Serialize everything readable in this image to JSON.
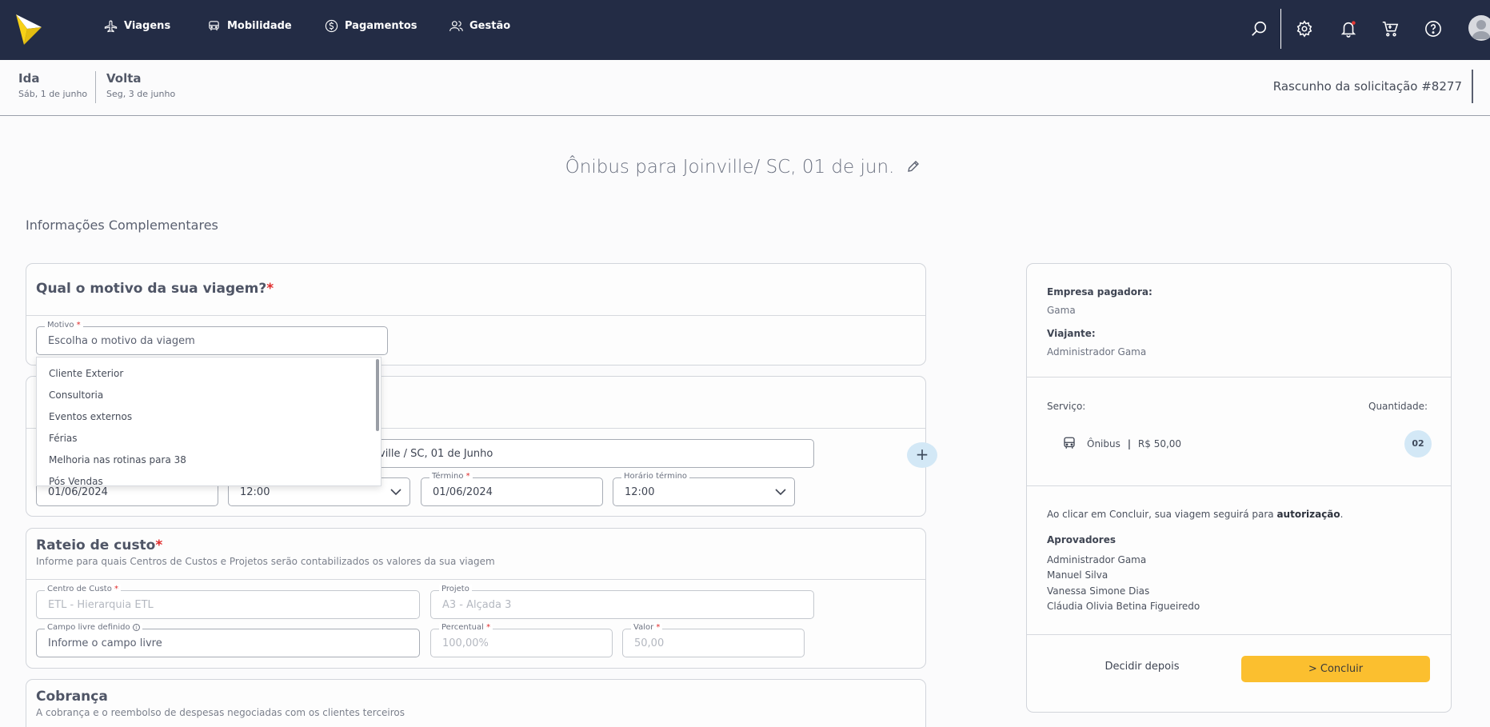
{
  "topbar": {
    "nav": [
      {
        "label": "Viagens",
        "icon": "airplane-icon"
      },
      {
        "label": "Mobilidade",
        "icon": "car-icon"
      },
      {
        "label": "Pagamentos",
        "icon": "dollar-icon"
      },
      {
        "label": "Gestão",
        "icon": "users-icon"
      }
    ],
    "icons": [
      "search-icon",
      "gear-icon",
      "bell-icon",
      "cart-icon",
      "help-icon",
      "avatar-icon"
    ],
    "bg_color": "#232c45",
    "logo_color": "#f7d117"
  },
  "trip": {
    "outbound": {
      "label": "Ida",
      "date": "Sáb, 1 de junho"
    },
    "return": {
      "label": "Volta",
      "date": "Seg, 3 de junho"
    },
    "draft": "Rascunho da solicitação #8277"
  },
  "page": {
    "heading": "Ônibus para Joinville/ SC, 01 de jun.",
    "section_title": "Informações Complementares"
  },
  "reason": {
    "title": "Qual o motivo da sua viagem?",
    "required_mark": "*",
    "field_label": "Motivo",
    "field_placeholder": "Escolha o motivo da viagem",
    "options": [
      "Cliente Exterior",
      "Consultoria",
      "Eventos externos",
      "Férias",
      "Melhoria nas rotinas para 38",
      "Pós Vendas"
    ]
  },
  "schedule": {
    "description_value": "ville / SC, 01 de Junho",
    "start_date": "01/06/2024",
    "start_time": "12:00",
    "end_label": "Término",
    "end_date": "01/06/2024",
    "end_time_label": "Horário término",
    "end_time": "12:00",
    "add_label": "+"
  },
  "cost": {
    "title": "Rateio de custo",
    "required_mark": "*",
    "subtitle": "Informe para quais Centros de Custos e Projetos serão contabilizados os valores da sua viagem",
    "cost_center_label": "Centro de Custo",
    "cost_center_value": "ETL - Hierarquia ETL",
    "project_label": "Projeto",
    "project_value": "A3 - Alçada 3",
    "free_field_label": "Campo livre definido",
    "free_field_placeholder": "Informe o campo livre",
    "percent_label": "Percentual",
    "percent_value": "100,00%",
    "value_label": "Valor",
    "value_value": "50,00"
  },
  "billing": {
    "title": "Cobrança",
    "subtitle": "A cobrança e o reembolso de despesas negociadas com os clientes terceiros"
  },
  "summary": {
    "payer_label": "Empresa pagadora:",
    "payer_value": "Gama",
    "traveler_label": "Viajante:",
    "traveler_value": "Administrador Gama",
    "service_label": "Serviço:",
    "quantity_label": "Quantidade:",
    "service_name": "Ônibus",
    "service_sep": "|",
    "service_price": "R$ 50,00",
    "quantity": "02",
    "notice_prefix": "Ao clicar em Concluir, sua viagem seguirá para ",
    "notice_bold": "autorização",
    "notice_suffix": ".",
    "approvers_label": "Aprovadores",
    "approvers": [
      "Administrador Gama",
      "Manuel Silva",
      "Vanessa Simone Dias",
      "Cláudia Olivia Betina Figueiredo"
    ],
    "later_button": "Decidir depois",
    "conclude_button": "> Concluir",
    "accent_color": "#fbbf2f"
  }
}
